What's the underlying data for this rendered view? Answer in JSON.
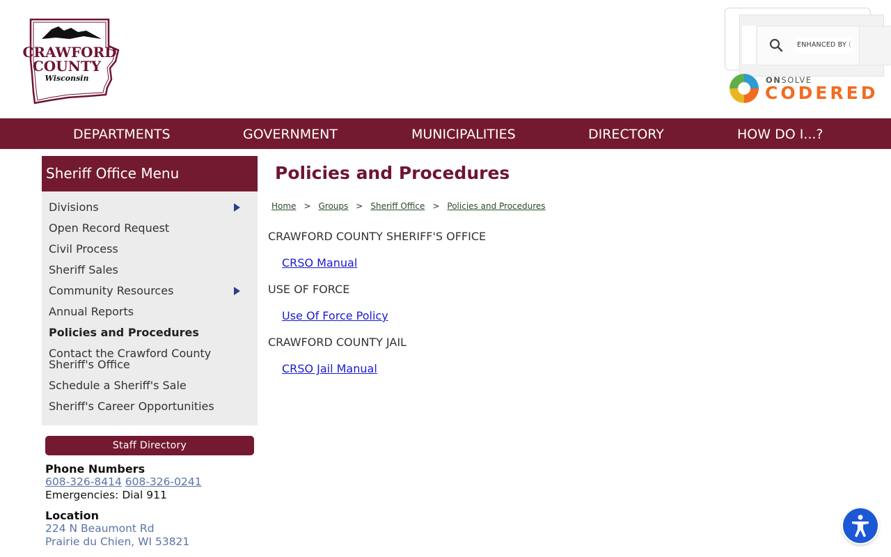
{
  "header": {
    "logo": {
      "line1": "CRAWFORD",
      "line2": "COUNTY",
      "line3": "Wisconsin"
    },
    "search": {
      "enhanced_label": "ENHANCED BY",
      "icon": "search-icon"
    },
    "codered": {
      "brand_prefix": "ON",
      "brand_suffix": "SOLVE",
      "wordmark": "CODERED"
    }
  },
  "nav": {
    "items": [
      "DEPARTMENTS",
      "GOVERNMENT",
      "MUNICIPALITIES",
      "DIRECTORY",
      "HOW DO I...?"
    ]
  },
  "sidebar": {
    "title": "Sheriff Office Menu",
    "items": [
      {
        "label": "Divisions"
      },
      {
        "label": "Open Record Request"
      },
      {
        "label": "Civil Process"
      },
      {
        "label": "Sheriff Sales"
      },
      {
        "label": "Community Resources"
      },
      {
        "label": "Annual Reports"
      },
      {
        "label": "Policies and Procedures"
      },
      {
        "label": "Contact the Crawford County Sheriff's Office"
      },
      {
        "label": "Schedule a Sheriff's Sale"
      },
      {
        "label": "Sheriff's Career Opportunities"
      }
    ],
    "staff_button": "Staff Directory",
    "phone_heading": "Phone Numbers",
    "phone1": "608-326-8414",
    "phone2": "608-326-0241",
    "emergency": "Emergencies: Dial 911",
    "location_heading": "Location",
    "address1": "224 N Beaumont Rd",
    "address2": "Prairie du Chien, WI 53821"
  },
  "main": {
    "title": "Policies and Procedures",
    "breadcrumb": [
      "Home",
      "Groups",
      "Sheriff Office",
      "Policies and Procedures"
    ],
    "breadcrumb_sep": ">",
    "sections": [
      {
        "heading": "CRAWFORD COUNTY SHERIFF'S OFFICE",
        "link": "CRSO Manual"
      },
      {
        "heading": "USE OF FORCE",
        "link": "Use Of Force Policy"
      },
      {
        "heading": "CRAWFORD COUNTY JAIL",
        "link": "CRSO Jail Manual"
      }
    ]
  },
  "colors": {
    "brand": "#731a30",
    "title": "#6e1530",
    "link": "#1a1ad0",
    "codered": "#f26b21",
    "a11y": "#1c57d6"
  }
}
